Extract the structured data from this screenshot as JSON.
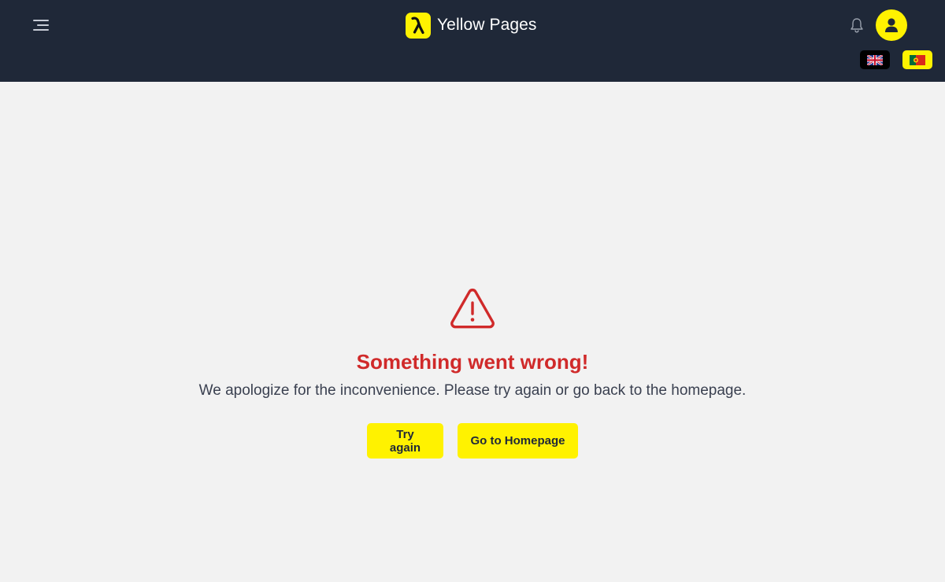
{
  "header": {
    "title": "Yellow Pages",
    "icons": {
      "menu": "menu-icon",
      "logo": "walking-fingers-icon",
      "notifications": "bell-icon",
      "account": "user-icon"
    },
    "languages": [
      {
        "code": "en",
        "icon": "uk-flag-icon",
        "active": false
      },
      {
        "code": "pt",
        "icon": "portugal-flag-icon",
        "active": true
      }
    ]
  },
  "error": {
    "icon": "warning-triangle-icon",
    "title": "Something went wrong!",
    "message": "We apologize for the inconvenience. Please try again or go back to the homepage.",
    "actions": {
      "retry_label": "Try again",
      "home_label": "Go to Homepage"
    }
  },
  "colors": {
    "header_bg": "#1f2838",
    "accent": "#fff200",
    "page_bg": "#f2f2f2",
    "error": "#d02a2a",
    "text": "#3a4050"
  }
}
